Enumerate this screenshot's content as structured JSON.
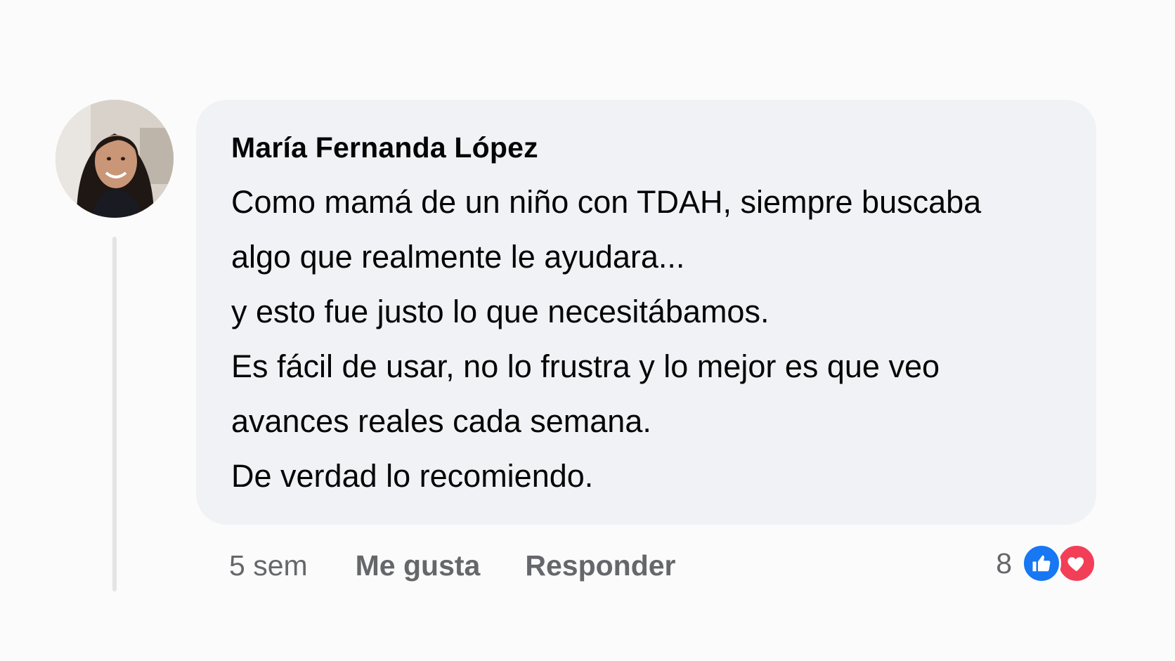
{
  "comment": {
    "author": "María Fernanda López",
    "body_lines": [
      "Como mamá de un niño con TDAH, siempre buscaba",
      "algo que realmente le ayudara...",
      "y esto fue justo lo que necesitábamos.",
      "Es fácil de usar, no lo frustra y lo mejor es que veo",
      "avances reales cada semana.",
      "De verdad lo recomiendo."
    ],
    "time": "5 sem",
    "like_label": "Me gusta",
    "reply_label": "Responder",
    "reactions": {
      "count": "8",
      "types": [
        "like-icon",
        "love-icon"
      ],
      "like_color": "#1877f2",
      "love_color": "#f33e58"
    }
  },
  "colors": {
    "bubble": "#f0f2f5",
    "text": "#050505",
    "secondary_text": "#65676b",
    "thread_line": "#e3e4e6"
  }
}
